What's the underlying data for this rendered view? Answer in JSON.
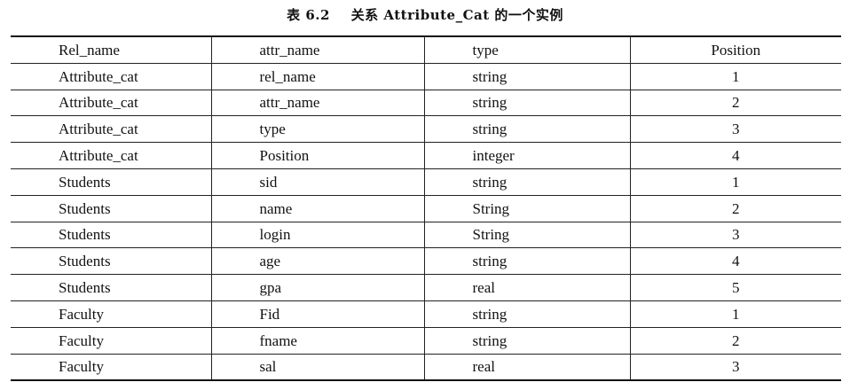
{
  "caption": {
    "label": "表 6.2",
    "title": "关系 Attribute_Cat 的一个实例"
  },
  "table": {
    "columns": [
      "Rel_name",
      "attr_name",
      "type",
      "Position"
    ],
    "rows": [
      [
        "Attribute_cat",
        "rel_name",
        "string",
        "1"
      ],
      [
        "Attribute_cat",
        "attr_name",
        "string",
        "2"
      ],
      [
        "Attribute_cat",
        "type",
        "string",
        "3"
      ],
      [
        "Attribute_cat",
        "Position",
        "integer",
        "4"
      ],
      [
        "Students",
        "sid",
        "string",
        "1"
      ],
      [
        "Students",
        "name",
        "String",
        "2"
      ],
      [
        "Students",
        "login",
        "String",
        "3"
      ],
      [
        "Students",
        "age",
        "string",
        "4"
      ],
      [
        "Students",
        "gpa",
        "real",
        "5"
      ],
      [
        "Faculty",
        "Fid",
        "string",
        "1"
      ],
      [
        "Faculty",
        "fname",
        "string",
        "2"
      ],
      [
        "Faculty",
        "sal",
        "real",
        "3"
      ]
    ]
  }
}
